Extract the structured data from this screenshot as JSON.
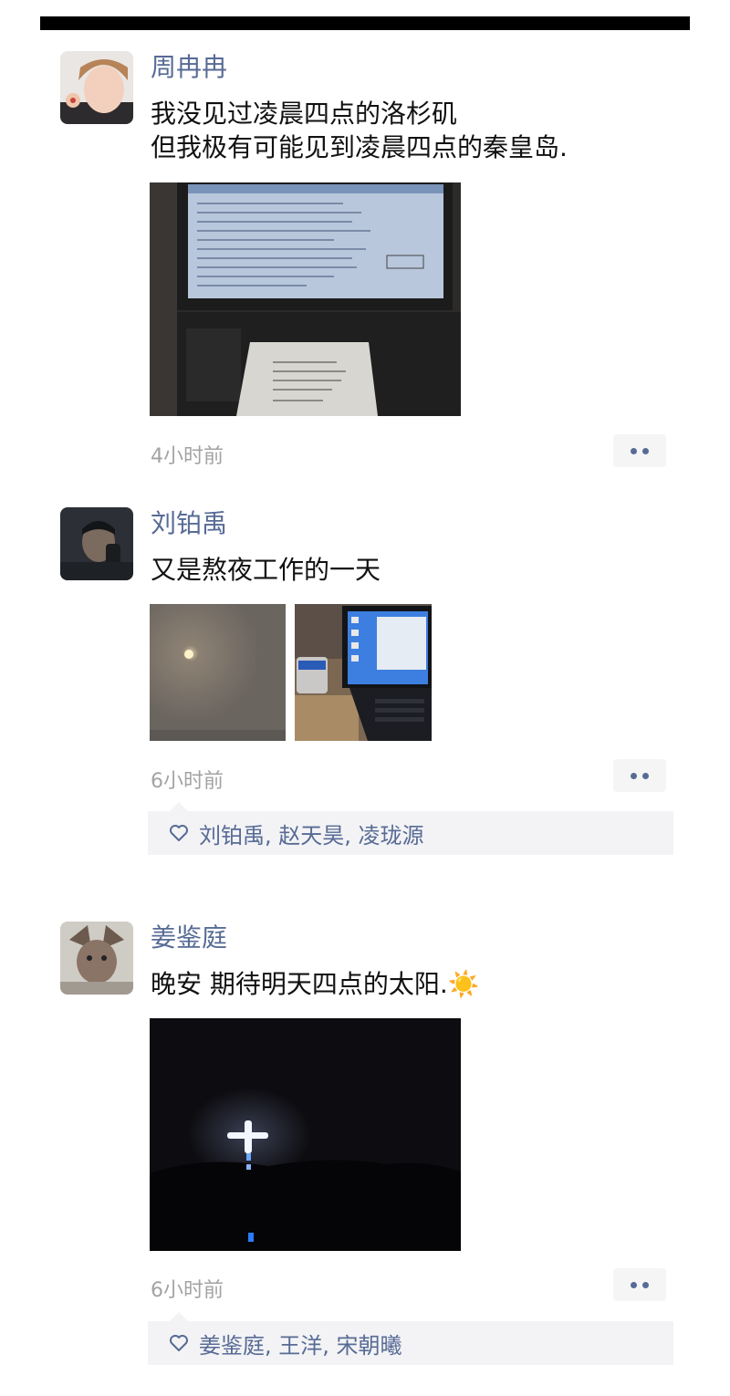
{
  "posts": [
    {
      "name": "周冉冉",
      "text_lines": [
        "我没见过凌晨四点的洛杉矶",
        "但我极有可能见到凌晨四点的秦皇岛."
      ],
      "time": "4小时前"
    },
    {
      "name": "刘铂禹",
      "text_lines": [
        "又是熬夜工作的一天"
      ],
      "time": "6小时前",
      "likes": "刘铂禹, 赵天昊, 凌珑源"
    },
    {
      "name": "姜鉴庭",
      "text_lines": [
        "晚安 期待明天四点的太阳."
      ],
      "emoji": "☀️",
      "time": "6小时前",
      "likes": "姜鉴庭, 王洋, 宋朝曦"
    }
  ],
  "icons": {
    "more": "more-dots-icon",
    "like": "heart-outline-icon"
  },
  "colors": {
    "name": "#576b95",
    "text": "#111111",
    "time": "#a3a3a3",
    "likes_bg": "#f3f3f5"
  }
}
